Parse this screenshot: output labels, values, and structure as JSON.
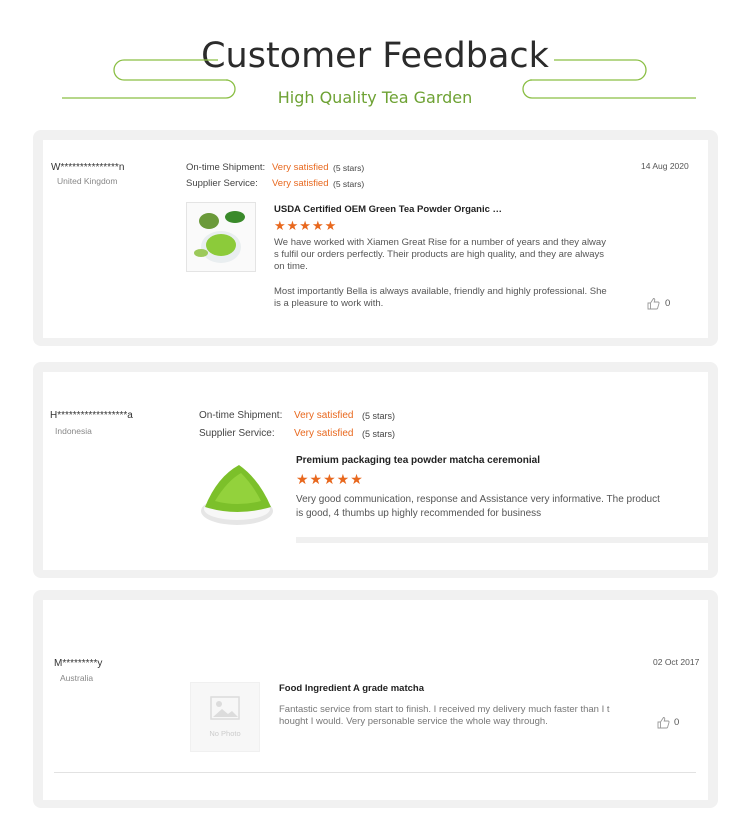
{
  "header": {
    "title": "Customer Feedback",
    "subtitle": "High Quality Tea Garden"
  },
  "colors": {
    "accent_green": "#6ea234",
    "satisfied_orange": "#e8681e",
    "card_bg": "#f1f1f1"
  },
  "reviews": [
    {
      "user": "W***************n",
      "country": "United Kingdom",
      "shipment_label": "On-time Shipment:",
      "shipment_value": "Very satisfied",
      "shipment_stars": "(5 stars)",
      "supplier_label": "Supplier Service:",
      "supplier_value": "Very satisfied",
      "supplier_stars": "(5 stars)",
      "date": "14 Aug 2020",
      "product_title": "USDA Certified OEM Green Tea Powder Organic Japa...",
      "rating": 5,
      "text": "We have worked with Xiamen Great Rise for a number of years and they always fulfil our orders perfectly. Their products are high quality, and they are always on time.",
      "text2": "Most importantly Bella is always available, friendly and highly professional. She is a pleasure to work with.",
      "likes": "0",
      "icon": "thumbs-up-icon"
    },
    {
      "user": "H******************a",
      "country": "Indonesia",
      "shipment_label": "On-time Shipment:",
      "shipment_value": "Very satisfied",
      "shipment_stars": "(5 stars)",
      "supplier_label": "Supplier Service:",
      "supplier_value": "Very satisfied",
      "supplier_stars": "(5 stars)",
      "product_title": "Premium packaging tea powder matcha ceremonial",
      "rating": 5,
      "text": "Very good communication, response and Assistance very informative. The product is good, 4 thumbs up highly recommended for business"
    },
    {
      "user": "M*********y",
      "country": "Australia",
      "date": "02 Oct 2017",
      "product_title": "Food Ingredient A grade matcha",
      "no_photo_label": "No Photo",
      "text": "Fantastic service from start to finish.  I received my delivery much faster than I thought I would.  Very personable service the whole way through.",
      "likes": "0",
      "icon": "thumbs-up-icon"
    }
  ]
}
